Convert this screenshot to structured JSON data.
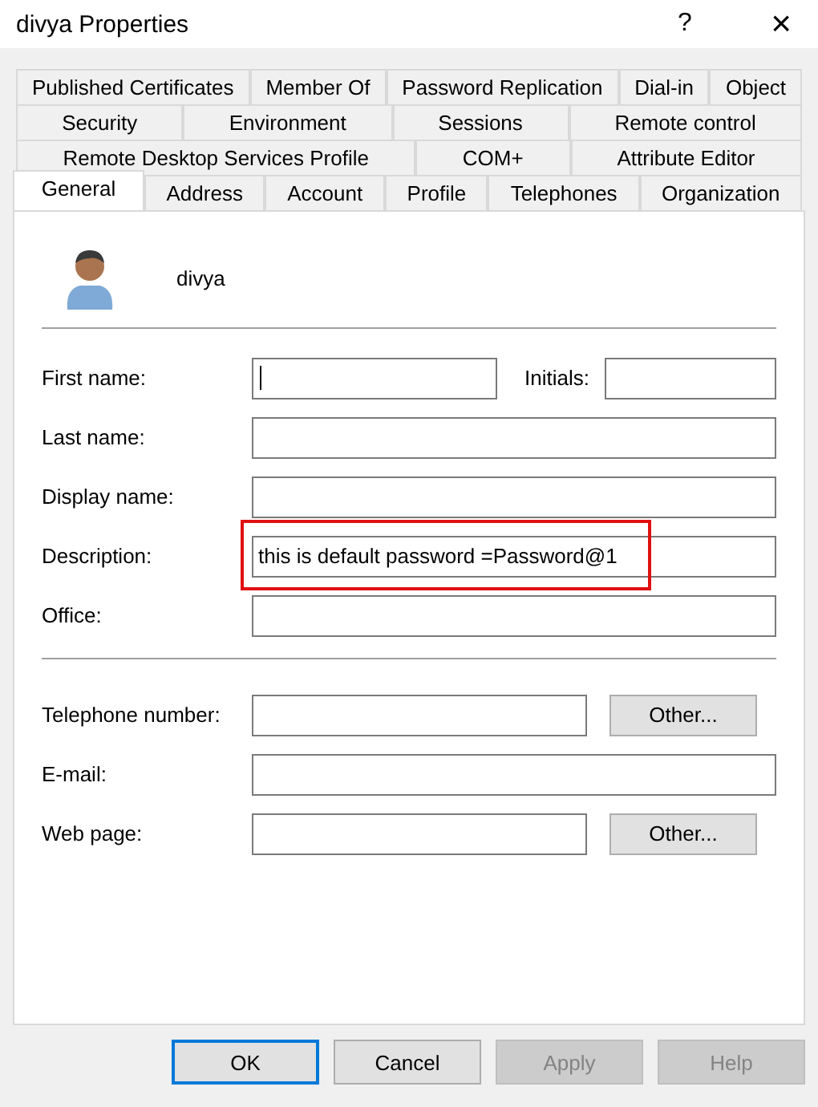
{
  "window": {
    "title": "divya Properties",
    "help": "?",
    "close": "×"
  },
  "tab_rows": [
    [
      {
        "label": "Published Certificates",
        "selected": false
      },
      {
        "label": "Member Of",
        "selected": false
      },
      {
        "label": "Password Replication",
        "selected": false
      },
      {
        "label": "Dial-in",
        "selected": false
      },
      {
        "label": "Object",
        "selected": false
      }
    ],
    [
      {
        "label": "Security",
        "selected": false
      },
      {
        "label": "Environment",
        "selected": false
      },
      {
        "label": "Sessions",
        "selected": false
      },
      {
        "label": "Remote control",
        "selected": false
      }
    ],
    [
      {
        "label": "Remote Desktop Services Profile",
        "selected": false
      },
      {
        "label": "COM+",
        "selected": false
      },
      {
        "label": "Attribute Editor",
        "selected": false
      }
    ],
    [
      {
        "label": "General",
        "selected": true
      },
      {
        "label": "Address",
        "selected": false
      },
      {
        "label": "Account",
        "selected": false
      },
      {
        "label": "Profile",
        "selected": false
      },
      {
        "label": "Telephones",
        "selected": false
      },
      {
        "label": "Organization",
        "selected": false
      }
    ]
  ],
  "user": {
    "name": "divya"
  },
  "sections": [
    {
      "fields": [
        {
          "kind": "split",
          "label": "First name:",
          "focused": true,
          "highlighted": false,
          "extra_label": "Initials:"
        },
        {
          "kind": "text",
          "label": "Last name:",
          "focused": false,
          "highlighted": false
        },
        {
          "kind": "text",
          "label": "Display name:",
          "focused": false,
          "highlighted": false
        },
        {
          "kind": "text",
          "label": "Description:",
          "value": "this is default password =Password@1",
          "focused": false,
          "highlighted": true
        },
        {
          "kind": "text",
          "label": "Office:",
          "focused": false,
          "highlighted": false
        }
      ]
    },
    {
      "fields": [
        {
          "kind": "button",
          "label": "Telephone number:",
          "button": "Other...",
          "focused": false,
          "highlighted": false
        },
        {
          "kind": "text",
          "label": "E-mail:",
          "focused": false,
          "highlighted": false
        },
        {
          "kind": "button",
          "label": "Web page:",
          "button": "Other...",
          "focused": false,
          "highlighted": false
        }
      ]
    }
  ],
  "buttons": [
    {
      "label": "OK",
      "default": true,
      "disabled": false
    },
    {
      "label": "Cancel",
      "default": false,
      "disabled": false
    },
    {
      "label": "Apply",
      "default": false,
      "disabled": true
    },
    {
      "label": "Help",
      "default": false,
      "disabled": true
    }
  ]
}
